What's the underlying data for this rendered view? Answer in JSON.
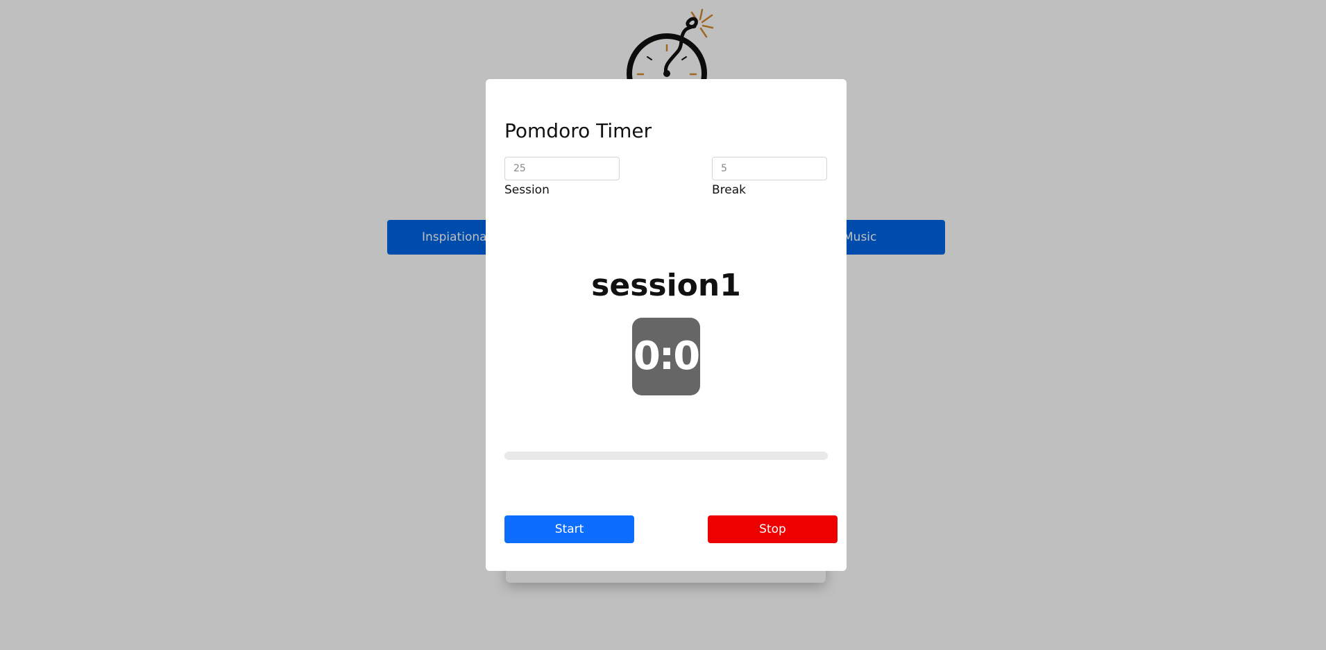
{
  "background": {
    "left_button_label": "Inspiational",
    "right_button_label": "Music"
  },
  "modal": {
    "title": "Pomdoro Timer",
    "session_field": {
      "placeholder": "25",
      "label": "Session"
    },
    "break_field": {
      "placeholder": "5",
      "label": "Break"
    },
    "session_name": "session1",
    "timer_display": "0:0",
    "progress": 0,
    "start_label": "Start",
    "stop_label": "Stop"
  },
  "colors": {
    "primary": "#0d6efd",
    "danger": "#ee0000",
    "timer_bg": "#666666",
    "bar_blue": "#0066e6"
  },
  "icons": {
    "logo": "bomb-clock-icon"
  }
}
